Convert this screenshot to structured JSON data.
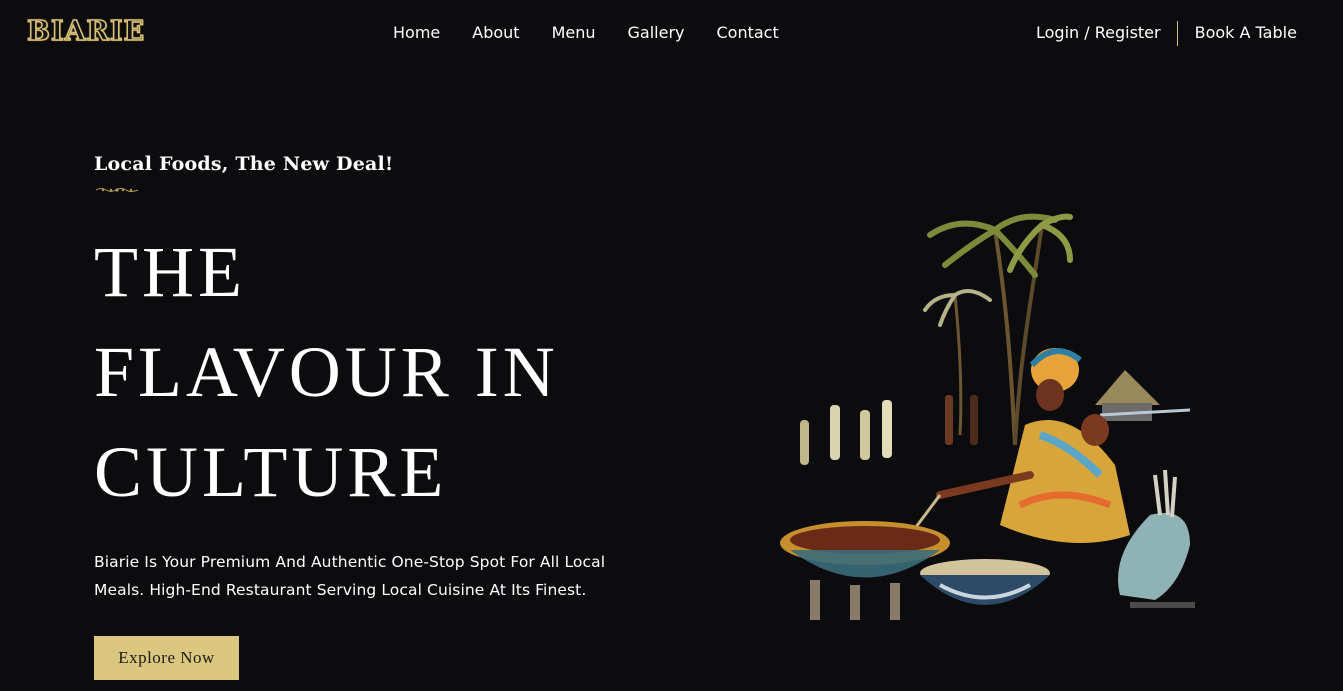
{
  "header": {
    "logo_text": "BIARIE",
    "nav": [
      {
        "label": "Home"
      },
      {
        "label": "About"
      },
      {
        "label": "Menu"
      },
      {
        "label": "Gallery"
      },
      {
        "label": "Contact"
      }
    ],
    "login_label": "Login / Register",
    "book_label": "Book A Table"
  },
  "hero": {
    "tagline": "Local Foods, The New Deal!",
    "headline_lines": [
      "THE",
      "FLAVOUR IN",
      "CULTURE"
    ],
    "description": "Biarie Is Your Premium And Authentic One-Stop Spot For All Local Meals. High-End Restaurant Serving Local Cuisine At Its Finest.",
    "cta_label": "Explore Now"
  },
  "colors": {
    "background": "#0c0b0d",
    "accent_gold": "#dcc77e",
    "text": "#ffffff"
  }
}
